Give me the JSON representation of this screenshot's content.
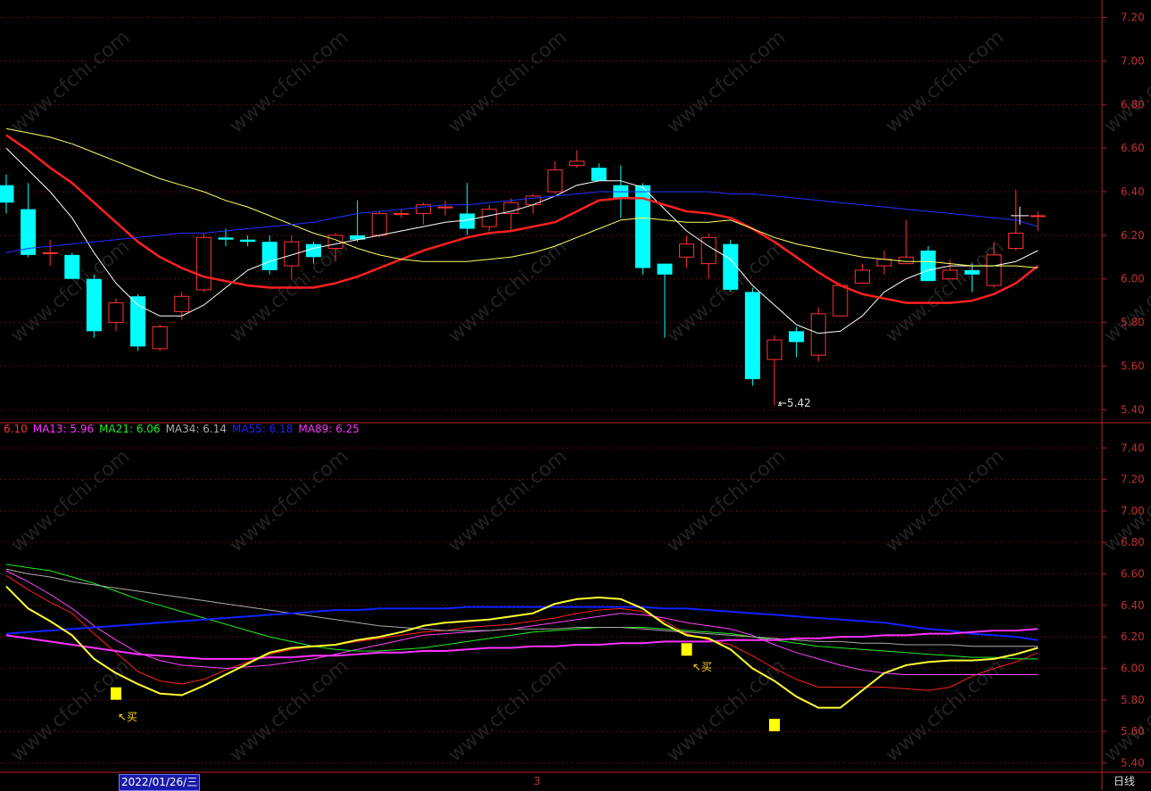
{
  "chart_data": [
    {
      "type": "candlestick",
      "ylim": [
        5.34,
        7.28
      ],
      "y_ticks": [
        "7.20",
        "7.00",
        "6.80",
        "6.60",
        "6.40",
        "6.20",
        "6.00",
        "5.80",
        "5.60",
        "5.40"
      ],
      "grid": true,
      "candles": [
        {
          "o": 6.43,
          "h": 6.48,
          "l": 6.3,
          "c": 6.35
        },
        {
          "o": 6.32,
          "h": 6.44,
          "l": 6.1,
          "c": 6.11
        },
        {
          "o": 6.12,
          "h": 6.18,
          "l": 6.06,
          "c": 6.12
        },
        {
          "o": 6.11,
          "h": 6.12,
          "l": 6.0,
          "c": 6.0
        },
        {
          "o": 6.0,
          "h": 6.02,
          "l": 5.73,
          "c": 5.76
        },
        {
          "o": 5.8,
          "h": 5.91,
          "l": 5.76,
          "c": 5.89
        },
        {
          "o": 5.92,
          "h": 5.93,
          "l": 5.67,
          "c": 5.69
        },
        {
          "o": 5.68,
          "h": 5.79,
          "l": 5.67,
          "c": 5.78
        },
        {
          "o": 5.85,
          "h": 5.94,
          "l": 5.81,
          "c": 5.92
        },
        {
          "o": 5.95,
          "h": 6.21,
          "l": 5.94,
          "c": 6.19
        },
        {
          "o": 6.19,
          "h": 6.23,
          "l": 6.15,
          "c": 6.18
        },
        {
          "o": 6.18,
          "h": 6.2,
          "l": 6.15,
          "c": 6.17
        },
        {
          "o": 6.17,
          "h": 6.2,
          "l": 6.02,
          "c": 6.04
        },
        {
          "o": 6.06,
          "h": 6.2,
          "l": 6.0,
          "c": 6.17
        },
        {
          "o": 6.16,
          "h": 6.17,
          "l": 6.07,
          "c": 6.1
        },
        {
          "o": 6.14,
          "h": 6.21,
          "l": 6.08,
          "c": 6.2
        },
        {
          "o": 6.2,
          "h": 6.36,
          "l": 6.17,
          "c": 6.18
        },
        {
          "o": 6.2,
          "h": 6.31,
          "l": 6.19,
          "c": 6.3
        },
        {
          "o": 6.3,
          "h": 6.32,
          "l": 6.28,
          "c": 6.3
        },
        {
          "o": 6.3,
          "h": 6.35,
          "l": 6.25,
          "c": 6.34
        },
        {
          "o": 6.33,
          "h": 6.36,
          "l": 6.29,
          "c": 6.33
        },
        {
          "o": 6.3,
          "h": 6.44,
          "l": 6.2,
          "c": 6.23
        },
        {
          "o": 6.24,
          "h": 6.34,
          "l": 6.22,
          "c": 6.32
        },
        {
          "o": 6.3,
          "h": 6.37,
          "l": 6.22,
          "c": 6.35
        },
        {
          "o": 6.34,
          "h": 6.39,
          "l": 6.3,
          "c": 6.38
        },
        {
          "o": 6.4,
          "h": 6.54,
          "l": 6.39,
          "c": 6.5
        },
        {
          "o": 6.52,
          "h": 6.59,
          "l": 6.51,
          "c": 6.54
        },
        {
          "o": 6.51,
          "h": 6.53,
          "l": 6.45,
          "c": 6.45
        },
        {
          "o": 6.43,
          "h": 6.52,
          "l": 6.28,
          "c": 6.37
        },
        {
          "o": 6.43,
          "h": 6.44,
          "l": 6.02,
          "c": 6.05
        },
        {
          "o": 6.07,
          "h": 6.07,
          "l": 5.73,
          "c": 6.02
        },
        {
          "o": 6.1,
          "h": 6.2,
          "l": 6.05,
          "c": 6.16
        },
        {
          "o": 6.07,
          "h": 6.21,
          "l": 6.0,
          "c": 6.19
        },
        {
          "o": 6.16,
          "h": 6.18,
          "l": 5.94,
          "c": 5.95
        },
        {
          "o": 5.94,
          "h": 5.96,
          "l": 5.51,
          "c": 5.54
        },
        {
          "o": 5.63,
          "h": 5.74,
          "l": 5.42,
          "c": 5.72
        },
        {
          "o": 5.76,
          "h": 5.78,
          "l": 5.64,
          "c": 5.71
        },
        {
          "o": 5.65,
          "h": 5.87,
          "l": 5.62,
          "c": 5.84
        },
        {
          "o": 5.83,
          "h": 5.98,
          "l": 5.83,
          "c": 5.97
        },
        {
          "o": 5.98,
          "h": 6.07,
          "l": 5.98,
          "c": 6.04
        },
        {
          "o": 6.06,
          "h": 6.13,
          "l": 6.02,
          "c": 6.09
        },
        {
          "o": 6.07,
          "h": 6.27,
          "l": 6.07,
          "c": 6.1
        },
        {
          "o": 6.13,
          "h": 6.15,
          "l": 5.99,
          "c": 5.99
        },
        {
          "o": 6.0,
          "h": 6.09,
          "l": 6.0,
          "c": 6.04
        },
        {
          "o": 6.04,
          "h": 6.07,
          "l": 5.94,
          "c": 6.02
        },
        {
          "o": 5.97,
          "h": 6.17,
          "l": 5.96,
          "c": 6.11
        },
        {
          "o": 6.14,
          "h": 6.41,
          "l": 6.13,
          "c": 6.21
        },
        {
          "o": 6.29,
          "h": 6.31,
          "l": 6.22,
          "c": 6.29
        }
      ],
      "lines": [
        {
          "name": "ma_white",
          "color": "#ffffff",
          "width": 1,
          "values": [
            6.6,
            6.5,
            6.4,
            6.28,
            6.12,
            5.98,
            5.88,
            5.83,
            5.83,
            5.88,
            5.96,
            6.04,
            6.08,
            6.11,
            6.14,
            6.16,
            6.18,
            6.2,
            6.22,
            6.24,
            6.26,
            6.27,
            6.29,
            6.31,
            6.34,
            6.38,
            6.43,
            6.45,
            6.45,
            6.42,
            6.32,
            6.22,
            6.15,
            6.09,
            5.97,
            5.88,
            5.79,
            5.75,
            5.76,
            5.83,
            5.94,
            6.0,
            6.04,
            6.06,
            6.06,
            6.06,
            6.08,
            6.13
          ]
        },
        {
          "name": "ma_red",
          "color": "#ff2020",
          "width": 2.5,
          "values": [
            6.66,
            6.59,
            6.51,
            6.44,
            6.35,
            6.26,
            6.17,
            6.1,
            6.05,
            6.01,
            5.99,
            5.97,
            5.96,
            5.96,
            5.96,
            5.98,
            6.01,
            6.05,
            6.09,
            6.13,
            6.16,
            6.19,
            6.21,
            6.22,
            6.24,
            6.26,
            6.31,
            6.36,
            6.37,
            6.37,
            6.34,
            6.31,
            6.3,
            6.28,
            6.23,
            6.17,
            6.1,
            6.03,
            5.97,
            5.93,
            5.91,
            5.89,
            5.89,
            5.89,
            5.9,
            5.93,
            5.98,
            6.06
          ]
        },
        {
          "name": "ma_yellow",
          "color": "#ffff66",
          "width": 1,
          "values": [
            6.69,
            6.67,
            6.65,
            6.62,
            6.58,
            6.54,
            6.5,
            6.46,
            6.43,
            6.4,
            6.36,
            6.33,
            6.29,
            6.25,
            6.21,
            6.18,
            6.14,
            6.11,
            6.09,
            6.08,
            6.08,
            6.08,
            6.09,
            6.1,
            6.12,
            6.15,
            6.19,
            6.23,
            6.27,
            6.28,
            6.27,
            6.26,
            6.26,
            6.27,
            6.23,
            6.19,
            6.16,
            6.14,
            6.12,
            6.1,
            6.09,
            6.08,
            6.08,
            6.07,
            6.06,
            6.06,
            6.06,
            6.05
          ]
        },
        {
          "name": "ma_blue",
          "color": "#2233ff",
          "width": 1,
          "values": [
            6.12,
            6.14,
            6.15,
            6.16,
            6.17,
            6.18,
            6.19,
            6.2,
            6.21,
            6.21,
            6.22,
            6.23,
            6.24,
            6.25,
            6.26,
            6.28,
            6.3,
            6.31,
            6.32,
            6.33,
            6.34,
            6.34,
            6.35,
            6.36,
            6.37,
            6.38,
            6.39,
            6.4,
            6.4,
            6.4,
            6.4,
            6.4,
            6.4,
            6.39,
            6.39,
            6.38,
            6.37,
            6.36,
            6.35,
            6.34,
            6.33,
            6.32,
            6.31,
            6.3,
            6.29,
            6.28,
            6.27,
            6.24
          ]
        }
      ],
      "annotations": [
        {
          "text": "←5.42",
          "value": 5.42
        }
      ]
    },
    {
      "type": "line",
      "ylim": [
        5.34,
        7.56
      ],
      "y_ticks": [
        "7.40",
        "7.20",
        "7.00",
        "6.80",
        "6.60",
        "6.40",
        "6.20",
        "6.00",
        "5.80",
        "5.60",
        "5.40"
      ],
      "grid": true,
      "legend": [
        {
          "label": "6.10",
          "color": "#ff3030"
        },
        {
          "label": "MA13: 5.96",
          "color": "#ff33ff"
        },
        {
          "label": "MA21: 6.06",
          "color": "#22ee22"
        },
        {
          "label": "MA34: 6.14",
          "color": "#aaaaaa"
        },
        {
          "label": "MA55: 6.18",
          "color": "#2222ff"
        },
        {
          "label": "MA89: 6.25",
          "color": "#ff33ff"
        }
      ],
      "series": [
        {
          "name": "6.10",
          "color": "#ff2020",
          "width": 1,
          "values": [
            6.59,
            6.5,
            6.42,
            6.35,
            6.22,
            6.1,
            5.98,
            5.92,
            5.9,
            5.93,
            5.99,
            6.04,
            6.09,
            6.12,
            6.14,
            6.15,
            6.17,
            6.19,
            6.21,
            6.23,
            6.24,
            6.26,
            6.27,
            6.28,
            6.3,
            6.32,
            6.35,
            6.37,
            6.38,
            6.36,
            6.3,
            6.22,
            6.18,
            6.15,
            6.08,
            6.0,
            5.93,
            5.88,
            5.88,
            5.88,
            5.88,
            5.87,
            5.86,
            5.88,
            5.95,
            6.0,
            6.04,
            6.1
          ]
        },
        {
          "name": "MA13",
          "color": "#ff44ff",
          "width": 1,
          "values": [
            6.62,
            6.55,
            6.47,
            6.38,
            6.27,
            6.18,
            6.1,
            6.05,
            6.02,
            6.01,
            6.0,
            6.01,
            6.02,
            6.04,
            6.06,
            6.09,
            6.12,
            6.15,
            6.18,
            6.21,
            6.22,
            6.23,
            6.24,
            6.25,
            6.27,
            6.29,
            6.31,
            6.33,
            6.35,
            6.34,
            6.32,
            6.29,
            6.27,
            6.25,
            6.21,
            6.15,
            6.1,
            6.06,
            6.02,
            5.99,
            5.97,
            5.96,
            5.96,
            5.96,
            5.96,
            5.96,
            5.96,
            5.96
          ]
        },
        {
          "name": "MA21",
          "color": "#22ee22",
          "width": 1,
          "values": [
            6.66,
            6.64,
            6.62,
            6.58,
            6.54,
            6.49,
            6.44,
            6.4,
            6.36,
            6.32,
            6.28,
            6.24,
            6.2,
            6.17,
            6.14,
            6.12,
            6.11,
            6.11,
            6.12,
            6.13,
            6.15,
            6.17,
            6.19,
            6.21,
            6.23,
            6.24,
            6.25,
            6.26,
            6.26,
            6.26,
            6.25,
            6.24,
            6.23,
            6.22,
            6.2,
            6.18,
            6.16,
            6.14,
            6.13,
            6.12,
            6.11,
            6.1,
            6.09,
            6.08,
            6.07,
            6.07,
            6.06,
            6.06
          ]
        },
        {
          "name": "MA34",
          "color": "#aaaaaa",
          "width": 1,
          "values": [
            6.63,
            6.6,
            6.58,
            6.55,
            6.53,
            6.51,
            6.49,
            6.47,
            6.45,
            6.43,
            6.41,
            6.39,
            6.37,
            6.35,
            6.33,
            6.31,
            6.29,
            6.27,
            6.26,
            6.25,
            6.24,
            6.24,
            6.24,
            6.25,
            6.25,
            6.25,
            6.26,
            6.26,
            6.26,
            6.25,
            6.24,
            6.23,
            6.22,
            6.21,
            6.2,
            6.19,
            6.18,
            6.17,
            6.17,
            6.16,
            6.16,
            6.15,
            6.15,
            6.15,
            6.14,
            6.14,
            6.14,
            6.14
          ]
        },
        {
          "name": "MA55",
          "color": "#1122ff",
          "width": 2,
          "values": [
            6.22,
            6.23,
            6.24,
            6.25,
            6.26,
            6.27,
            6.28,
            6.29,
            6.3,
            6.31,
            6.32,
            6.33,
            6.34,
            6.35,
            6.36,
            6.37,
            6.37,
            6.38,
            6.38,
            6.38,
            6.38,
            6.39,
            6.39,
            6.39,
            6.39,
            6.39,
            6.39,
            6.39,
            6.39,
            6.39,
            6.38,
            6.38,
            6.37,
            6.36,
            6.35,
            6.34,
            6.33,
            6.32,
            6.31,
            6.3,
            6.29,
            6.27,
            6.25,
            6.24,
            6.22,
            6.21,
            6.2,
            6.18
          ]
        },
        {
          "name": "MA89",
          "color": "#ff33ff",
          "width": 2,
          "values": [
            6.21,
            6.19,
            6.17,
            6.15,
            6.13,
            6.11,
            6.09,
            6.08,
            6.07,
            6.06,
            6.06,
            6.06,
            6.07,
            6.07,
            6.08,
            6.08,
            6.09,
            6.1,
            6.1,
            6.11,
            6.11,
            6.12,
            6.13,
            6.13,
            6.14,
            6.14,
            6.15,
            6.15,
            6.16,
            6.16,
            6.17,
            6.17,
            6.17,
            6.18,
            6.18,
            6.18,
            6.19,
            6.19,
            6.2,
            6.2,
            6.21,
            6.21,
            6.22,
            6.22,
            6.23,
            6.24,
            6.24,
            6.25
          ]
        },
        {
          "name": "yellow",
          "color": "#ffff33",
          "width": 2,
          "values": [
            6.52,
            6.38,
            6.3,
            6.21,
            6.06,
            5.97,
            5.9,
            5.84,
            5.83,
            5.89,
            5.96,
            6.03,
            6.1,
            6.13,
            6.14,
            6.15,
            6.18,
            6.2,
            6.23,
            6.27,
            6.29,
            6.3,
            6.31,
            6.33,
            6.35,
            6.41,
            6.44,
            6.45,
            6.44,
            6.38,
            6.28,
            6.21,
            6.19,
            6.12,
            6.0,
            5.92,
            5.82,
            5.75,
            5.75,
            5.86,
            5.97,
            6.02,
            6.04,
            6.05,
            6.05,
            6.06,
            6.09,
            6.13
          ]
        }
      ],
      "markers": [
        {
          "label": "买",
          "value": 5.84
        },
        {
          "label": "买",
          "value": 6.12
        },
        {
          "label": "",
          "value": 5.64
        }
      ]
    }
  ],
  "watermark": "www.cfchi.com",
  "bottom_bar": {
    "date": "2022/01/26/三",
    "mid": "3",
    "period": "日线"
  },
  "legend_texts": [
    "6.10",
    "MA13: 5.96",
    "MA21: 6.06",
    "MA34: 6.14",
    "MA55: 6.18",
    "MA89: 6.25"
  ],
  "annotation_text": "←5.42",
  "buy_label": "↖买"
}
